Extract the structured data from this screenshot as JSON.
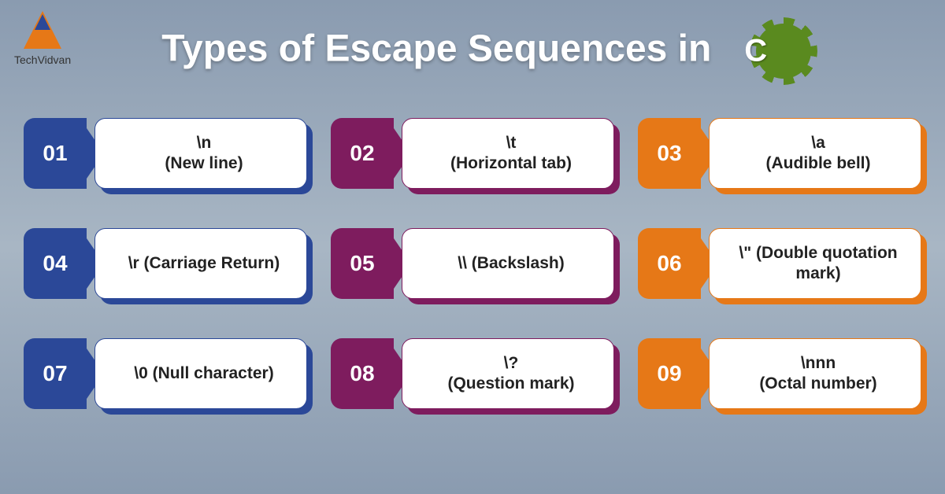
{
  "logo": {
    "brand": "TechVidvan"
  },
  "title": "Types of Escape Sequences in",
  "c_badge": "C",
  "colors": {
    "col1": "#2b4898",
    "col2": "#7e1c5e",
    "col3": "#e67817"
  },
  "items": [
    {
      "num": "01",
      "text": "\\n\n(New line)",
      "col": "col1"
    },
    {
      "num": "02",
      "text": "\\t\n(Horizontal tab)",
      "col": "col2"
    },
    {
      "num": "03",
      "text": "\\a\n(Audible bell)",
      "col": "col3"
    },
    {
      "num": "04",
      "text": "\\r (Carriage Return)",
      "col": "col1"
    },
    {
      "num": "05",
      "text": "\\\\ (Backslash)",
      "col": "col2"
    },
    {
      "num": "06",
      "text": "\\\" (Double quotation mark)",
      "col": "col3"
    },
    {
      "num": "07",
      "text": "\\0 (Null character)",
      "col": "col1"
    },
    {
      "num": "08",
      "text": "\\?\n(Question mark)",
      "col": "col2"
    },
    {
      "num": "09",
      "text": "\\nnn\n(Octal number)",
      "col": "col3"
    }
  ]
}
